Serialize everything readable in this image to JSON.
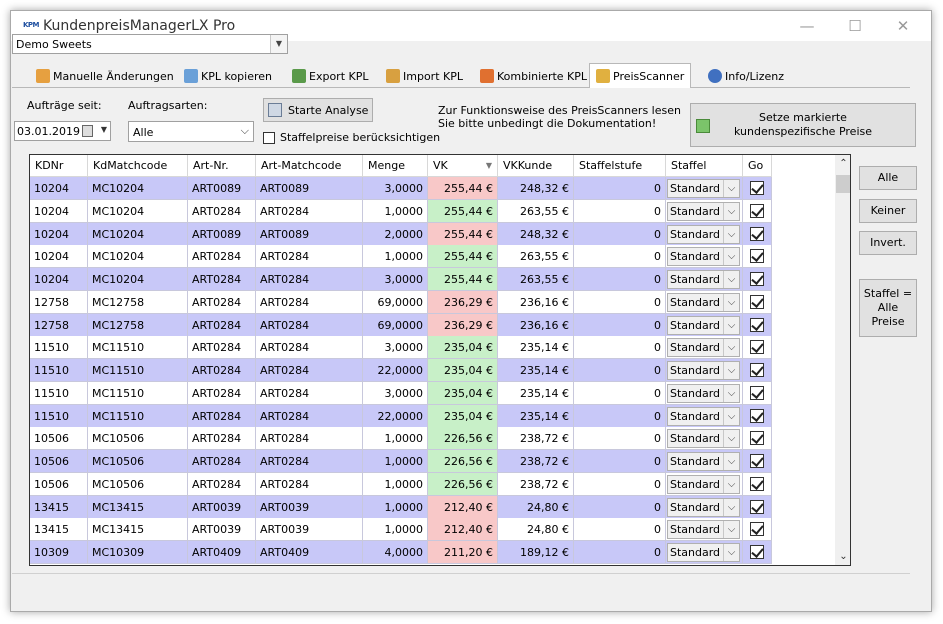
{
  "window": {
    "title": "KundenpreisManagerLX Pro",
    "icon_label": "KPM",
    "controls": [
      "—",
      "☐",
      "✕"
    ]
  },
  "company_select": {
    "value": "Demo Sweets"
  },
  "tabs": [
    {
      "label": "Manuelle Änderungen",
      "icon": "edit-icon",
      "color": "#e6a040"
    },
    {
      "label": "KPL kopieren",
      "icon": "copy-icon",
      "color": "#6aa0d8"
    },
    {
      "label": "Export KPL",
      "icon": "export-icon",
      "color": "#5a9a4a"
    },
    {
      "label": "Import KPL",
      "icon": "import-icon",
      "color": "#d8a040"
    },
    {
      "label": "Kombinierte KPL",
      "icon": "combine-icon",
      "color": "#e07030"
    },
    {
      "label": "PreisScanner",
      "icon": "scanner-icon",
      "color": "#e0b040",
      "active": true
    },
    {
      "label": "Info/Lizenz",
      "icon": "info-icon",
      "color": "#4070c0"
    }
  ],
  "filters": {
    "orders_since_label": "Aufträge seit:",
    "orders_since_value": "03.01.2019",
    "order_types_label": "Auftragsarten:",
    "order_types_value": "Alle",
    "analyse_button": "Starte Analyse",
    "staffel_checkbox_label": "Staffelpreise berücksichtigen",
    "info_line1": "Zur Funktionsweise des PreisScanners lesen",
    "info_line2": "Sie bitte unbedingt die Dokumentation!",
    "mark_button_line1": "Setze markierte",
    "mark_button_line2": "kundenspezifische Preise"
  },
  "grid": {
    "columns": [
      "KDNr",
      "KdMatchcode",
      "Art-Nr.",
      "Art-Matchcode",
      "Menge",
      "VK",
      "VKKunde",
      "Staffelstufe",
      "Staffel",
      "Go"
    ],
    "sort_indicator": "▼",
    "rows": [
      {
        "kdnr": "10204",
        "kdmatch": "MC10204",
        "artnr": "ART0089",
        "artmatch": "ART0089",
        "menge": "3,0000",
        "vk": "255,44 €",
        "vkkunde": "248,32 €",
        "stufe": "0",
        "staffel": "Standard",
        "vk_state": "red"
      },
      {
        "kdnr": "10204",
        "kdmatch": "MC10204",
        "artnr": "ART0284",
        "artmatch": "ART0284",
        "menge": "1,0000",
        "vk": "255,44 €",
        "vkkunde": "263,55 €",
        "stufe": "0",
        "staffel": "Standard",
        "vk_state": "green"
      },
      {
        "kdnr": "10204",
        "kdmatch": "MC10204",
        "artnr": "ART0089",
        "artmatch": "ART0089",
        "menge": "2,0000",
        "vk": "255,44 €",
        "vkkunde": "248,32 €",
        "stufe": "0",
        "staffel": "Standard",
        "vk_state": "red"
      },
      {
        "kdnr": "10204",
        "kdmatch": "MC10204",
        "artnr": "ART0284",
        "artmatch": "ART0284",
        "menge": "1,0000",
        "vk": "255,44 €",
        "vkkunde": "263,55 €",
        "stufe": "0",
        "staffel": "Standard",
        "vk_state": "green"
      },
      {
        "kdnr": "10204",
        "kdmatch": "MC10204",
        "artnr": "ART0284",
        "artmatch": "ART0284",
        "menge": "3,0000",
        "vk": "255,44 €",
        "vkkunde": "263,55 €",
        "stufe": "0",
        "staffel": "Standard",
        "vk_state": "green"
      },
      {
        "kdnr": "12758",
        "kdmatch": "MC12758",
        "artnr": "ART0284",
        "artmatch": "ART0284",
        "menge": "69,0000",
        "vk": "236,29 €",
        "vkkunde": "236,16 €",
        "stufe": "0",
        "staffel": "Standard",
        "vk_state": "red"
      },
      {
        "kdnr": "12758",
        "kdmatch": "MC12758",
        "artnr": "ART0284",
        "artmatch": "ART0284",
        "menge": "69,0000",
        "vk": "236,29 €",
        "vkkunde": "236,16 €",
        "stufe": "0",
        "staffel": "Standard",
        "vk_state": "red"
      },
      {
        "kdnr": "11510",
        "kdmatch": "MC11510",
        "artnr": "ART0284",
        "artmatch": "ART0284",
        "menge": "3,0000",
        "vk": "235,04 €",
        "vkkunde": "235,14 €",
        "stufe": "0",
        "staffel": "Standard",
        "vk_state": "green"
      },
      {
        "kdnr": "11510",
        "kdmatch": "MC11510",
        "artnr": "ART0284",
        "artmatch": "ART0284",
        "menge": "22,0000",
        "vk": "235,04 €",
        "vkkunde": "235,14 €",
        "stufe": "0",
        "staffel": "Standard",
        "vk_state": "green"
      },
      {
        "kdnr": "11510",
        "kdmatch": "MC11510",
        "artnr": "ART0284",
        "artmatch": "ART0284",
        "menge": "3,0000",
        "vk": "235,04 €",
        "vkkunde": "235,14 €",
        "stufe": "0",
        "staffel": "Standard",
        "vk_state": "green"
      },
      {
        "kdnr": "11510",
        "kdmatch": "MC11510",
        "artnr": "ART0284",
        "artmatch": "ART0284",
        "menge": "22,0000",
        "vk": "235,04 €",
        "vkkunde": "235,14 €",
        "stufe": "0",
        "staffel": "Standard",
        "vk_state": "green"
      },
      {
        "kdnr": "10506",
        "kdmatch": "MC10506",
        "artnr": "ART0284",
        "artmatch": "ART0284",
        "menge": "1,0000",
        "vk": "226,56 €",
        "vkkunde": "238,72 €",
        "stufe": "0",
        "staffel": "Standard",
        "vk_state": "green"
      },
      {
        "kdnr": "10506",
        "kdmatch": "MC10506",
        "artnr": "ART0284",
        "artmatch": "ART0284",
        "menge": "1,0000",
        "vk": "226,56 €",
        "vkkunde": "238,72 €",
        "stufe": "0",
        "staffel": "Standard",
        "vk_state": "green"
      },
      {
        "kdnr": "10506",
        "kdmatch": "MC10506",
        "artnr": "ART0284",
        "artmatch": "ART0284",
        "menge": "1,0000",
        "vk": "226,56 €",
        "vkkunde": "238,72 €",
        "stufe": "0",
        "staffel": "Standard",
        "vk_state": "green"
      },
      {
        "kdnr": "13415",
        "kdmatch": "MC13415",
        "artnr": "ART0039",
        "artmatch": "ART0039",
        "menge": "1,0000",
        "vk": "212,40 €",
        "vkkunde": "24,80 €",
        "stufe": "0",
        "staffel": "Standard",
        "vk_state": "red"
      },
      {
        "kdnr": "13415",
        "kdmatch": "MC13415",
        "artnr": "ART0039",
        "artmatch": "ART0039",
        "menge": "1,0000",
        "vk": "212,40 €",
        "vkkunde": "24,80 €",
        "stufe": "0",
        "staffel": "Standard",
        "vk_state": "red"
      },
      {
        "kdnr": "10309",
        "kdmatch": "MC10309",
        "artnr": "ART0409",
        "artmatch": "ART0409",
        "menge": "4,0000",
        "vk": "211,20 €",
        "vkkunde": "189,12 €",
        "stufe": "0",
        "staffel": "Standard",
        "vk_state": "red"
      }
    ]
  },
  "side_buttons": {
    "all": "Alle",
    "none": "Keiner",
    "invert": "Invert.",
    "staffel_line1": "Staffel =",
    "staffel_line2": "Alle",
    "staffel_line3": "Preise"
  },
  "colors": {
    "row_blue": "#c8c8f8",
    "vk_red": "#f8c8c8",
    "vk_green": "#c8f0c8"
  }
}
